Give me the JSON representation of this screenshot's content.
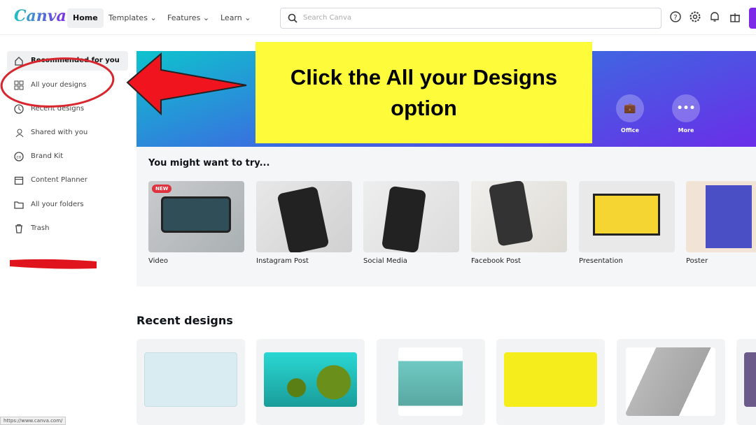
{
  "header": {
    "logo": "Canva",
    "nav": [
      "Home",
      "Templates",
      "Features",
      "Learn"
    ],
    "search_placeholder": "Search Canva"
  },
  "sidebar": {
    "items": [
      {
        "label": "Recommended for you",
        "icon": "home-icon"
      },
      {
        "label": "All your designs",
        "icon": "grid-icon"
      },
      {
        "label": "Recent designs",
        "icon": "clock-icon"
      },
      {
        "label": "Shared with you",
        "icon": "people-icon"
      },
      {
        "label": "Brand Kit",
        "icon": "brand-icon"
      },
      {
        "label": "Content Planner",
        "icon": "calendar-icon"
      },
      {
        "label": "All your folders",
        "icon": "folder-icon"
      },
      {
        "label": "Trash",
        "icon": "trash-icon"
      }
    ]
  },
  "banner": {
    "shortcuts": [
      "Office",
      "More"
    ]
  },
  "annotation": {
    "line1": "Click the All your Designs",
    "line2": "option",
    "arrow_color": "#f0141e",
    "box_color": "#fdfb3a"
  },
  "try": {
    "title": "You might want to try...",
    "badge": "NEW",
    "items": [
      "Video",
      "Instagram Post",
      "Social Media",
      "Facebook Post",
      "Presentation",
      "Poster"
    ]
  },
  "recent": {
    "title": "Recent designs"
  },
  "status_bar": "https://www.canva.com/"
}
